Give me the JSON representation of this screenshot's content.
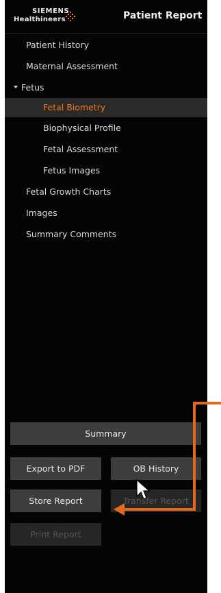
{
  "header": {
    "logo_line1": "SIEMENS",
    "logo_line2": "Healthineers",
    "title": "Patient Report"
  },
  "nav": {
    "items": [
      {
        "label": "Patient History"
      },
      {
        "label": "Maternal Assessment"
      },
      {
        "label": "Fetus"
      },
      {
        "label": "Fetal Biometry",
        "selected": true
      },
      {
        "label": "Biophysical Profile"
      },
      {
        "label": "Fetal Assessment"
      },
      {
        "label": "Fetus Images"
      },
      {
        "label": "Fetal Growth Charts"
      },
      {
        "label": "Images"
      },
      {
        "label": "Summary Comments"
      }
    ]
  },
  "buttons": {
    "summary": "Summary",
    "export_pdf": "Export to PDF",
    "ob_history": "OB History",
    "store_report": "Store Report",
    "transfer_report": "Transfer Report",
    "print_report": "Print Report"
  },
  "colors": {
    "accent": "#f07a23",
    "panel_bg": "#050505",
    "button_bg": "#3d3d3d",
    "annotation_arrow": "#e8681a"
  },
  "icons": {
    "collapse": "caret-down-icon",
    "logo_mark": "siemens-dots-logo",
    "pointer": "mouse-pointer-icon"
  }
}
